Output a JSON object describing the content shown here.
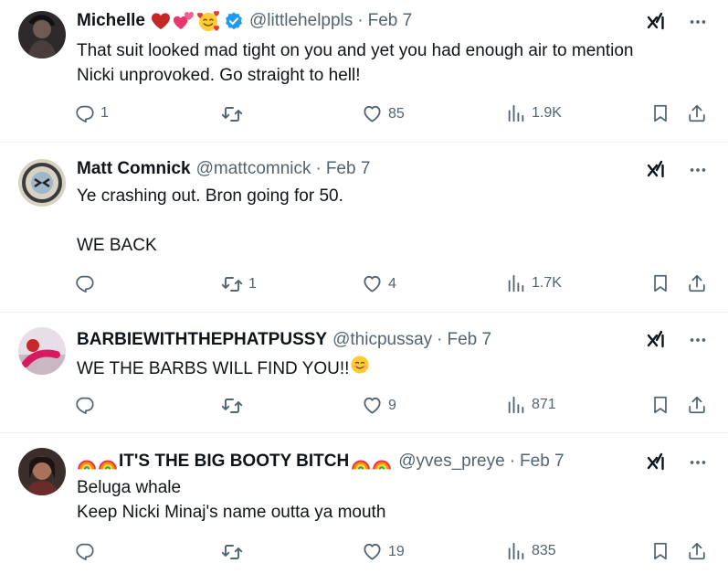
{
  "tweets": [
    {
      "name": "Michelle",
      "name_emojis": [
        "red-heart",
        "two-hearts",
        "smiling-face-with-hearts"
      ],
      "verified": true,
      "handle": "@littlehelppls",
      "separator": "·",
      "date": "Feb 7",
      "text_lines": [
        "That suit looked mad tight on you and yet you had enough air to mention",
        "Nicki unprovoked. Go straight to hell!"
      ],
      "replies": "1",
      "retweets": "",
      "likes": "85",
      "views": "1.9K"
    },
    {
      "name": "Matt Comnick",
      "verified": false,
      "handle": "@mattcomnick",
      "separator": "·",
      "date": "Feb 7",
      "text_lines": [
        "Ye crashing out. Bron going for 50.",
        "",
        "WE BACK"
      ],
      "replies": "",
      "retweets": "1",
      "likes": "4",
      "views": "1.7K"
    },
    {
      "name": "BARBIEWITHTHEPHATPUSSY",
      "verified": false,
      "handle": "@thicpussay",
      "separator": "·",
      "date": "Feb 7",
      "text": "WE THE BARBS WILL FIND YOU!!",
      "text_emoji": "smiling-face",
      "replies": "",
      "retweets": "",
      "likes": "9",
      "views": "871"
    },
    {
      "name_prefix_emojis": [
        "rainbow",
        "rainbow"
      ],
      "name": "IT'S THE BIG BOOTY BITCH",
      "name_suffix_emojis": [
        "rainbow",
        "rainbow"
      ],
      "verified": false,
      "handle": "@yves_preye",
      "separator": "·",
      "date": "Feb 7",
      "text_lines": [
        "Beluga whale",
        "Keep Nicki Minaj's name outta ya mouth"
      ],
      "replies": "",
      "retweets": "",
      "likes": "19",
      "views": "835"
    }
  ],
  "colors": {
    "text": "#0f1419",
    "secondary": "#536471",
    "verified": "#1d9bf0",
    "divider": "#eff3f4"
  },
  "icons": [
    "reply-icon",
    "retweet-icon",
    "like-icon",
    "views-icon",
    "bookmark-icon",
    "share-icon",
    "grok-icon",
    "more-icon",
    "verified-badge-icon"
  ]
}
